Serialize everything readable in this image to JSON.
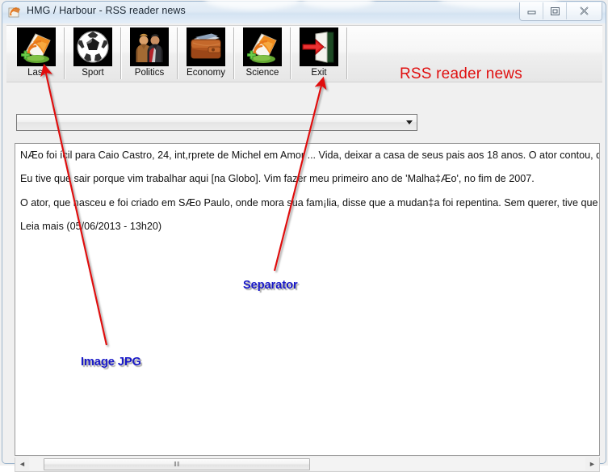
{
  "window": {
    "title": "HMG / Harbour -  RSS reader news",
    "icon": "application-icon",
    "caption_buttons": [
      {
        "name": "minimize",
        "glyph": "–"
      },
      {
        "name": "maximize",
        "glyph": "▣"
      },
      {
        "name": "close",
        "glyph": "✕"
      }
    ]
  },
  "toolbar": {
    "items": [
      {
        "label": "Last",
        "icon": "rss-add-icon"
      },
      {
        "label": "Sport",
        "icon": "soccer-ball-icon"
      },
      {
        "label": "Politics",
        "icon": "people-talking-icon"
      },
      {
        "label": "Economy",
        "icon": "wallet-icon"
      },
      {
        "label": "Science",
        "icon": "rss-add-icon"
      },
      {
        "label": "Exit",
        "icon": "exit-door-arrow-icon"
      }
    ]
  },
  "banner": {
    "text": "RSS reader news",
    "color": "#e01010"
  },
  "combo": {
    "value": "",
    "placeholder": "",
    "arrow_icon": "chevron-down-icon"
  },
  "content": {
    "lines": [
      "NÆo foi ícil para Caio Castro, 24, int,rprete de Michel em Amor ... Vida, deixar a casa de seus pais aos 18 anos. O ator contou, dur",
      "Eu tive que sair porque vim trabalhar aqui [na Globo]. Vim fazer meu primeiro ano de 'Malha‡Æo', no fim de 2007.",
      "O ator, que nasceu e foi criado em SÆo Paulo, onde mora sua fam¡lia, disse que a mudan‡a foi repentina. Sem querer, tive que co",
      "Leia mais (05/06/2013 - 13h20)"
    ]
  },
  "scrollbar": {
    "left_arrow": "◄",
    "right_arrow": "►",
    "grip": "‖‖",
    "thumb_position_percent": 2,
    "thumb_width_percent": 47
  },
  "annotations": [
    {
      "name": "image-jpg",
      "text": "Image JPG",
      "color": "#1818c8"
    },
    {
      "name": "separator",
      "text": "Separator",
      "color": "#1818c8"
    }
  ]
}
